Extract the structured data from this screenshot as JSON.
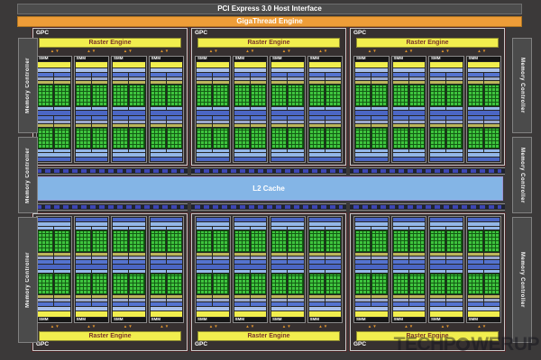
{
  "header": {
    "pci_label": "PCI Express 3.0 Host Interface",
    "gigathread_label": "GigaThread Engine"
  },
  "gpc": {
    "label": "GPC",
    "raster_label": "Raster Engine",
    "sm_label": "SMM",
    "top_count": 3,
    "bottom_count": 3,
    "sms_per_gpc": 4,
    "processing_blocks_per_sm": 4,
    "arrow_icon": "up-down-arrows"
  },
  "l2_cache": {
    "label": "L2 Cache"
  },
  "memory_controllers": {
    "label": "Memory Controller",
    "left_count": 3,
    "right_count": 3
  },
  "watermark": {
    "text_left": "TECHP",
    "text_right": "WERUP",
    "logo": "gear-circle-icon"
  },
  "colors": {
    "bg": "#3b3939",
    "bargray": "#4c4c4c",
    "orange": "#ee9d38",
    "gpcfill": "#363030",
    "gpcborder": "#c9c9c9",
    "smfill": "#262524",
    "smborder": "#8a8a8a",
    "yellow": "#f1ee4e",
    "rastertext": "#7a352a",
    "periwinkle": "#a9bfe8",
    "blue": "#5473d0",
    "lavender": "#9aa8cc",
    "olive": "#bcb75c",
    "lightblue": "#93b7e8",
    "royal": "#4b66c4",
    "green": "#3ec43e",
    "greendark": "#145c14",
    "l2fill": "#84b5e6",
    "l2border": "#9b94d6",
    "mcfill": "#4b4b4b",
    "xbarbg": "#20242e",
    "xdash": "#3d46b5",
    "arrow": "#e0952f"
  }
}
